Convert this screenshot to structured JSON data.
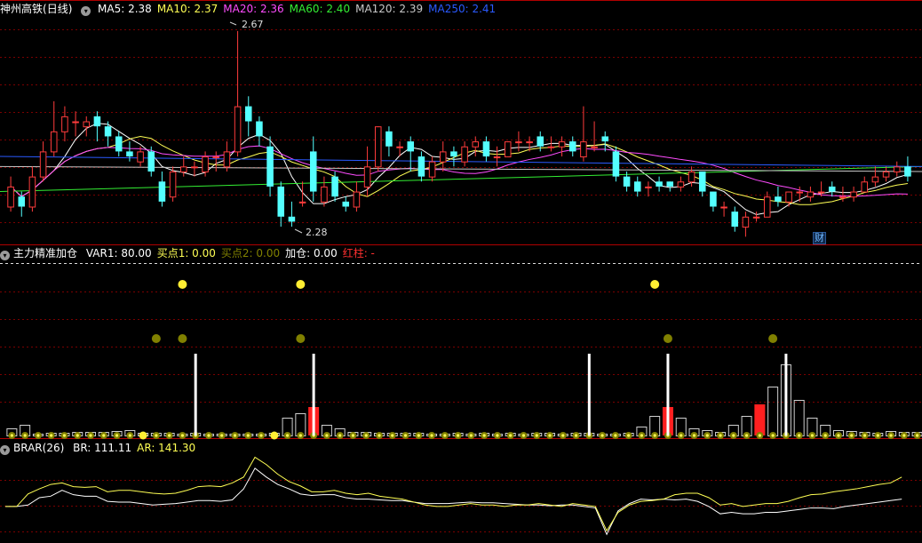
{
  "stock": {
    "name": "神州高铁",
    "period": "(日线)"
  },
  "ma_legend": [
    {
      "label": "MA5: 2.38",
      "color": "#ffffff"
    },
    {
      "label": "MA10: 2.37",
      "color": "#ffff54"
    },
    {
      "label": "MA20: 2.36",
      "color": "#ff4cff"
    },
    {
      "label": "MA60: 2.40",
      "color": "#33ee33"
    },
    {
      "label": "MA120: 2.39",
      "color": "#c8c8c8"
    },
    {
      "label": "MA250: 2.41",
      "color": "#2a5aff"
    }
  ],
  "price_marks": {
    "high": "2.67",
    "low": "2.28"
  },
  "badge": "财",
  "indicator2": {
    "name": "主力精准加仓",
    "items": [
      {
        "label": "VAR1: 80.00",
        "color": "#ffffff"
      },
      {
        "label": "买点1: 0.00",
        "color": "#ffff54"
      },
      {
        "label": "买点2: 0.00",
        "color": "#808000"
      },
      {
        "label": "加仓: 0.00",
        "color": "#ffffff"
      },
      {
        "label": "红柱: -",
        "color": "#ff3030"
      }
    ]
  },
  "indicator3": {
    "name": "BRAR(26)",
    "items": [
      {
        "label": "BR: 111.11",
        "color": "#ffffff"
      },
      {
        "label": "AR: 141.30",
        "color": "#ffff54"
      }
    ]
  },
  "colors": {
    "up": "#ff3c3c",
    "down": "#54ffff",
    "grid": "#7a0000",
    "frame": "#b00000"
  },
  "chart_data": {
    "type": "candlestick",
    "ylim": [
      2.25,
      2.7
    ],
    "candles": [
      [
        2.32,
        2.36,
        2.38,
        2.31
      ],
      [
        2.34,
        2.32,
        2.35,
        2.3
      ],
      [
        2.32,
        2.38,
        2.4,
        2.31
      ],
      [
        2.38,
        2.43,
        2.45,
        2.37
      ],
      [
        2.43,
        2.47,
        2.53,
        2.42
      ],
      [
        2.47,
        2.5,
        2.52,
        2.45
      ],
      [
        2.49,
        2.49,
        2.51,
        2.46
      ],
      [
        2.48,
        2.49,
        2.5,
        2.46
      ],
      [
        2.5,
        2.48,
        2.51,
        2.45
      ],
      [
        2.48,
        2.46,
        2.49,
        2.44
      ],
      [
        2.46,
        2.43,
        2.47,
        2.42
      ],
      [
        2.43,
        2.42,
        2.45,
        2.41
      ],
      [
        2.41,
        2.43,
        2.44,
        2.4
      ],
      [
        2.43,
        2.39,
        2.44,
        2.38
      ],
      [
        2.37,
        2.33,
        2.39,
        2.32
      ],
      [
        2.34,
        2.39,
        2.4,
        2.33
      ],
      [
        2.39,
        2.4,
        2.42,
        2.38
      ],
      [
        2.4,
        2.4,
        2.41,
        2.38
      ],
      [
        2.39,
        2.42,
        2.43,
        2.38
      ],
      [
        2.42,
        2.42,
        2.43,
        2.39
      ],
      [
        2.4,
        2.43,
        2.45,
        2.39
      ],
      [
        2.43,
        2.52,
        2.67,
        2.42
      ],
      [
        2.52,
        2.49,
        2.54,
        2.46
      ],
      [
        2.49,
        2.46,
        2.5,
        2.44
      ],
      [
        2.44,
        2.36,
        2.46,
        2.34
      ],
      [
        2.36,
        2.3,
        2.37,
        2.28
      ],
      [
        2.3,
        2.29,
        2.33,
        2.28
      ],
      [
        2.33,
        2.33,
        2.37,
        2.32
      ],
      [
        2.43,
        2.35,
        2.46,
        2.33
      ],
      [
        2.33,
        2.36,
        2.38,
        2.32
      ],
      [
        2.38,
        2.34,
        2.39,
        2.33
      ],
      [
        2.33,
        2.32,
        2.34,
        2.31
      ],
      [
        2.32,
        2.35,
        2.37,
        2.31
      ],
      [
        2.36,
        2.4,
        2.44,
        2.34
      ],
      [
        2.4,
        2.48,
        2.48,
        2.39
      ],
      [
        2.47,
        2.44,
        2.48,
        2.42
      ],
      [
        2.44,
        2.44,
        2.45,
        2.42
      ],
      [
        2.45,
        2.43,
        2.46,
        2.39
      ],
      [
        2.42,
        2.38,
        2.43,
        2.37
      ],
      [
        2.38,
        2.41,
        2.42,
        2.37
      ],
      [
        2.41,
        2.43,
        2.45,
        2.39
      ],
      [
        2.43,
        2.42,
        2.44,
        2.4
      ],
      [
        2.41,
        2.44,
        2.45,
        2.4
      ],
      [
        2.44,
        2.45,
        2.46,
        2.42
      ],
      [
        2.45,
        2.42,
        2.46,
        2.41
      ],
      [
        2.42,
        2.42,
        2.44,
        2.4
      ],
      [
        2.42,
        2.45,
        2.45,
        2.42
      ],
      [
        2.45,
        2.45,
        2.47,
        2.43
      ],
      [
        2.45,
        2.45,
        2.46,
        2.43
      ],
      [
        2.46,
        2.44,
        2.47,
        2.43
      ],
      [
        2.44,
        2.44,
        2.46,
        2.43
      ],
      [
        2.44,
        2.45,
        2.46,
        2.42
      ],
      [
        2.45,
        2.43,
        2.46,
        2.42
      ],
      [
        2.42,
        2.45,
        2.52,
        2.41
      ],
      [
        2.44,
        2.44,
        2.49,
        2.43
      ],
      [
        2.46,
        2.45,
        2.47,
        2.43
      ],
      [
        2.43,
        2.38,
        2.44,
        2.37
      ],
      [
        2.38,
        2.36,
        2.39,
        2.35
      ],
      [
        2.37,
        2.35,
        2.38,
        2.34
      ],
      [
        2.36,
        2.36,
        2.37,
        2.34
      ],
      [
        2.37,
        2.36,
        2.38,
        2.35
      ],
      [
        2.37,
        2.36,
        2.37,
        2.35
      ],
      [
        2.36,
        2.37,
        2.38,
        2.35
      ],
      [
        2.37,
        2.39,
        2.4,
        2.36
      ],
      [
        2.39,
        2.35,
        2.39,
        2.34
      ],
      [
        2.35,
        2.32,
        2.35,
        2.31
      ],
      [
        2.32,
        2.32,
        2.33,
        2.3
      ],
      [
        2.31,
        2.28,
        2.32,
        2.27
      ],
      [
        2.28,
        2.3,
        2.31,
        2.26
      ],
      [
        2.3,
        2.3,
        2.31,
        2.29
      ],
      [
        2.3,
        2.34,
        2.35,
        2.3
      ],
      [
        2.34,
        2.33,
        2.36,
        2.32
      ],
      [
        2.33,
        2.35,
        2.35,
        2.32
      ],
      [
        2.35,
        2.35,
        2.36,
        2.33
      ],
      [
        2.34,
        2.35,
        2.36,
        2.33
      ],
      [
        2.35,
        2.35,
        2.37,
        2.34
      ],
      [
        2.36,
        2.35,
        2.37,
        2.34
      ],
      [
        2.34,
        2.34,
        2.36,
        2.33
      ],
      [
        2.34,
        2.35,
        2.36,
        2.33
      ],
      [
        2.35,
        2.37,
        2.38,
        2.35
      ],
      [
        2.37,
        2.38,
        2.4,
        2.36
      ],
      [
        2.38,
        2.39,
        2.4,
        2.37
      ],
      [
        2.39,
        2.4,
        2.41,
        2.38
      ],
      [
        2.4,
        2.38,
        2.42,
        2.37
      ]
    ],
    "ma_flat": {
      "MA60": [
        2.35,
        2.4
      ],
      "MA120": [
        2.4,
        2.39
      ],
      "MA250": [
        2.42,
        2.4
      ]
    },
    "volume_bars": [
      [
        0,
        8
      ],
      [
        0,
        12
      ],
      [
        0,
        2
      ],
      [
        0,
        3
      ],
      [
        0,
        3
      ],
      [
        0,
        4
      ],
      [
        0,
        4
      ],
      [
        0,
        4
      ],
      [
        0,
        5
      ],
      [
        0,
        6
      ],
      [
        0,
        3
      ],
      [
        0,
        3
      ],
      [
        0,
        3
      ],
      [
        0,
        2
      ],
      [
        0,
        3
      ],
      [
        0,
        2
      ],
      [
        0,
        2
      ],
      [
        0,
        2
      ],
      [
        0,
        2
      ],
      [
        0,
        2
      ],
      [
        0,
        3
      ],
      [
        0,
        20
      ],
      [
        0,
        25
      ],
      [
        1,
        32
      ],
      [
        0,
        12
      ],
      [
        0,
        8
      ],
      [
        0,
        4
      ],
      [
        0,
        4
      ],
      [
        0,
        3
      ],
      [
        0,
        3
      ],
      [
        0,
        3
      ],
      [
        0,
        3
      ],
      [
        0,
        2
      ],
      [
        0,
        2
      ],
      [
        0,
        3
      ],
      [
        0,
        2
      ],
      [
        0,
        3
      ],
      [
        0,
        2
      ],
      [
        0,
        3
      ],
      [
        0,
        2
      ],
      [
        0,
        3
      ],
      [
        0,
        3
      ],
      [
        0,
        2
      ],
      [
        0,
        3
      ],
      [
        0,
        3
      ],
      [
        0,
        2
      ],
      [
        0,
        2
      ],
      [
        0,
        3
      ],
      [
        0,
        10
      ],
      [
        0,
        22
      ],
      [
        1,
        32
      ],
      [
        0,
        20
      ],
      [
        0,
        8
      ],
      [
        0,
        6
      ],
      [
        0,
        4
      ],
      [
        0,
        12
      ],
      [
        0,
        22
      ],
      [
        1,
        35
      ],
      [
        0,
        55
      ],
      [
        0,
        80
      ],
      [
        0,
        40
      ],
      [
        0,
        20
      ],
      [
        0,
        12
      ],
      [
        0,
        6
      ],
      [
        0,
        5
      ],
      [
        0,
        4
      ],
      [
        0,
        3
      ],
      [
        0,
        5
      ],
      [
        0,
        4
      ],
      [
        0,
        4
      ]
    ],
    "volume_offset": 20,
    "white_spikes": [
      14,
      23,
      44,
      50,
      59
    ],
    "buy1_points": [
      13,
      22,
      49
    ],
    "buy2_points": [
      11,
      13,
      22,
      50,
      58
    ],
    "br": [
      28,
      28,
      30,
      40,
      42,
      50,
      44,
      42,
      42,
      35,
      34,
      34,
      32,
      30,
      31,
      32,
      34,
      36,
      36,
      35,
      37,
      52,
      80,
      68,
      58,
      52,
      45,
      43,
      44,
      44,
      40,
      38,
      38,
      37,
      36,
      36,
      34,
      32,
      32,
      32,
      33,
      34,
      33,
      33,
      32,
      31,
      30,
      30,
      29,
      30,
      30,
      28,
      26,
      -10,
      22,
      32,
      38,
      37,
      38,
      37,
      38,
      35,
      28,
      18,
      20,
      18,
      18,
      20,
      20,
      22,
      24,
      26,
      26,
      25,
      28,
      30,
      32,
      34,
      36,
      38
    ],
    "ar": [
      28,
      28,
      45,
      52,
      58,
      60,
      55,
      54,
      55,
      48,
      50,
      50,
      48,
      46,
      45,
      46,
      50,
      55,
      56,
      55,
      60,
      68,
      95,
      85,
      72,
      62,
      56,
      48,
      48,
      50,
      46,
      44,
      46,
      42,
      40,
      38,
      34,
      30,
      28,
      28,
      30,
      32,
      30,
      30,
      28,
      30,
      30,
      32,
      30,
      28,
      32,
      30,
      28,
      -5,
      20,
      30,
      35,
      36,
      38,
      44,
      46,
      46,
      40,
      30,
      32,
      28,
      30,
      32,
      32,
      35,
      40,
      44,
      45,
      48,
      50,
      52,
      55,
      58,
      60,
      68
    ]
  }
}
